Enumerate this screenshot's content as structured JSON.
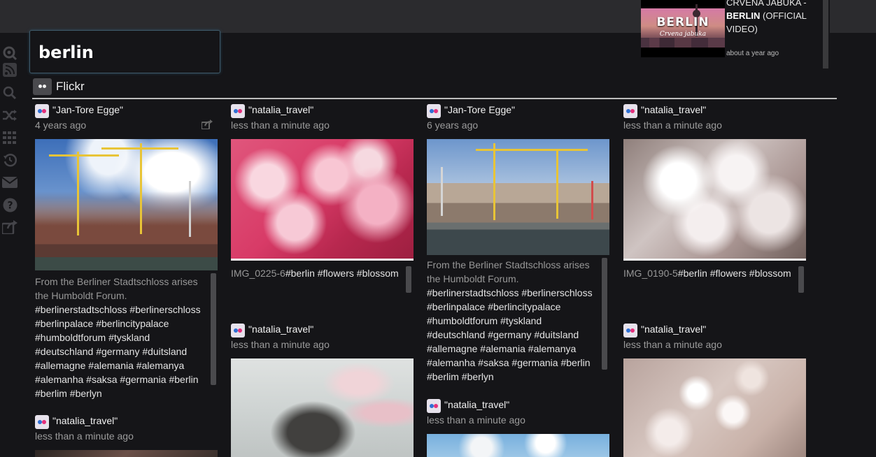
{
  "search": {
    "value": "berlin"
  },
  "source": {
    "label": "Flickr"
  },
  "video": {
    "title_prefix": "CRVENA JABUKA -",
    "title_highlight": "BERLIN",
    "title_suffix": "(OFFICIAL VIDEO)",
    "time": "about a year ago",
    "thumb_title": "BERLIN",
    "thumb_subtitle": "Crvena jabuka"
  },
  "sidebar": {
    "icons": [
      "settings-icon",
      "rss-icon",
      "search-icon",
      "shuffle-icon",
      "grid-icon",
      "history-icon",
      "mail-icon",
      "help-icon",
      "share-icon"
    ]
  },
  "cards": [
    {
      "author": "\"Jan-Tore Egge\"",
      "time": "4 years ago",
      "desc": "From the Berliner Stadtschloss arises the Humboldt Forum.",
      "tags": [
        "#berlinerstadtschloss",
        "#berlinerschloss",
        "#berlinpalace",
        "#berlincitypalace",
        "#humboldtforum",
        "#tyskland",
        "#deutschland",
        "#germany",
        "#duitsland",
        "#allemagne",
        "#alemania",
        "#alemanya",
        "#alemanha",
        "#saksa",
        "#germania",
        "#berlin",
        "#berlim",
        "#berlyn"
      ]
    },
    {
      "author": "\"natalia_travel\"",
      "time": "less than a minute ago",
      "desc": "IMG_0225-6",
      "tags": [
        "#berlin",
        "#flowers",
        "#blossom"
      ]
    },
    {
      "author": "\"Jan-Tore Egge\"",
      "time": "6 years ago",
      "desc": "From the Berliner Stadtschloss arises the Humboldt Forum.",
      "tags": [
        "#berlinerstadtschloss",
        "#berlinerschloss",
        "#berlinpalace",
        "#berlincitypalace",
        "#humboldtforum",
        "#tyskland",
        "#deutschland",
        "#germany",
        "#duitsland",
        "#allemagne",
        "#alemania",
        "#alemanya",
        "#alemanha",
        "#saksa",
        "#germania",
        "#berlin",
        "#berlim",
        "#berlyn"
      ]
    },
    {
      "author": "\"natalia_travel\"",
      "time": "less than a minute ago",
      "desc": "IMG_0190-5",
      "tags": [
        "#berlin",
        "#flowers",
        "#blossom"
      ]
    },
    {
      "author": "\"natalia_travel\"",
      "time": "less than a minute ago"
    },
    {
      "author": "\"natalia_travel\"",
      "time": "less than a minute ago"
    },
    {
      "author": "\"natalia_travel\"",
      "time": "less than a minute ago"
    },
    {
      "author": "\"natalia_travel\"",
      "time": "less than a minute ago"
    }
  ]
}
